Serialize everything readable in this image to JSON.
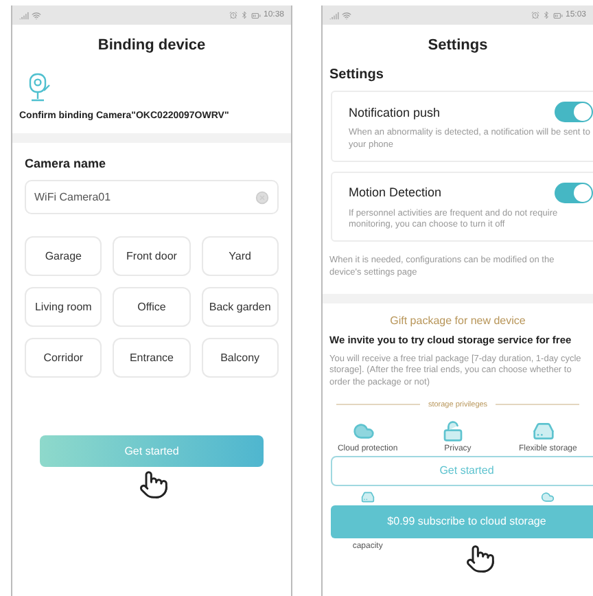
{
  "binding_screen": {
    "status_bar": {
      "time": "10:38"
    },
    "title": "Binding device",
    "confirm_text": "Confirm binding  Camera\"OKC0220097OWRV\"",
    "camera_name_label": "Camera name",
    "camera_name_field": {
      "value": "WiFi Camera01"
    },
    "locations": [
      {
        "label": "Garage"
      },
      {
        "label": "Front door"
      },
      {
        "label": "Yard"
      },
      {
        "label": "Living room"
      },
      {
        "label": "Office"
      },
      {
        "label": "Back garden"
      },
      {
        "label": "Corridor"
      },
      {
        "label": "Entrance"
      },
      {
        "label": "Balcony"
      }
    ],
    "primary_button": "Get started"
  },
  "settings_screen": {
    "status_bar": {
      "time": "15:03"
    },
    "title": "Settings",
    "section_title": "Settings",
    "settings": [
      {
        "name": "Notification push",
        "on": true,
        "description": "When an abnormality is detected, a notification will be sent to your phone"
      },
      {
        "name": "Motion Detection",
        "on": true,
        "description": "If personnel activities are frequent and do not require monitoring, you can choose to turn it off"
      }
    ],
    "note": "When it is needed, configurations can be modified on the device's settings page",
    "gift_title": "Gift package for new device",
    "invite_title": "We invite you to try cloud storage service for free",
    "invite_description": "You will receive a free trial package [7-day duration, 1-day cycle storage]. (After the free trial ends, you can choose whether to order the package or not)",
    "privileges_heading": "storage privileges",
    "privileges": [
      {
        "label": "Cloud protection"
      },
      {
        "label": "Privacy"
      },
      {
        "label": "Flexible storage"
      }
    ],
    "get_started_button": "Get started",
    "partial_privilege_label": "capacity",
    "subscribe_button": "$0.99 subscribe to cloud storage"
  }
}
